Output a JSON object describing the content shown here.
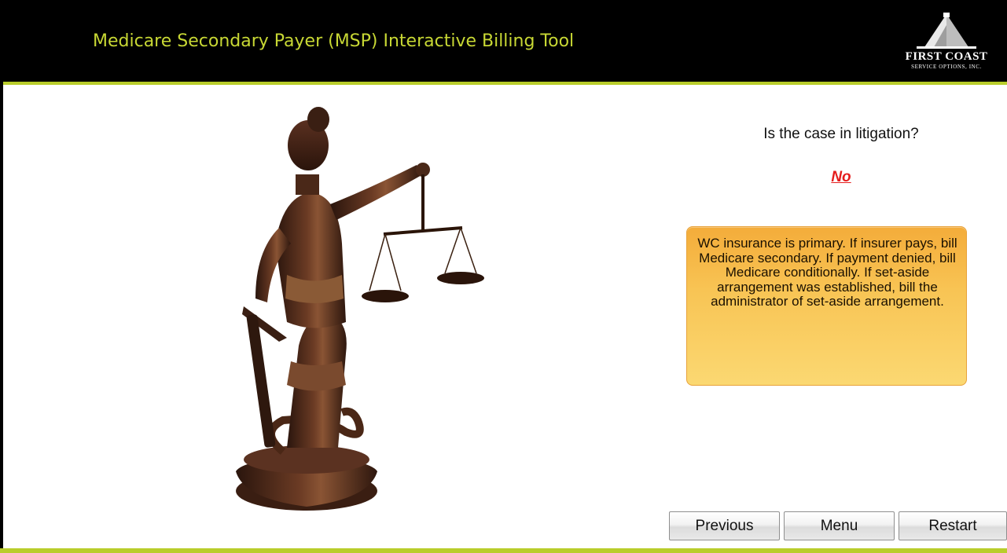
{
  "header": {
    "title": "Medicare Secondary Payer (MSP) Interactive Billing Tool",
    "logo": {
      "name": "FIRST COAST",
      "subtitle": "SERVICE OPTIONS, INC."
    }
  },
  "main": {
    "image_icon": "lady-justice-statue",
    "question": "Is the case in litigation?",
    "answer": "No",
    "result": "WC insurance is primary. If insurer pays, bill Medicare secondary. If payment denied, bill Medicare conditionally. If set-aside arrangement was established, bill the administrator of set-aside arrangement."
  },
  "nav": {
    "previous_label": "Previous",
    "menu_label": "Menu",
    "restart_label": "Restart"
  },
  "colors": {
    "header_bg": "#000000",
    "title_color": "#c8d834",
    "accent_line": "#b9cd2b",
    "answer_color": "#e51c1c",
    "result_box": "#f8c454"
  }
}
